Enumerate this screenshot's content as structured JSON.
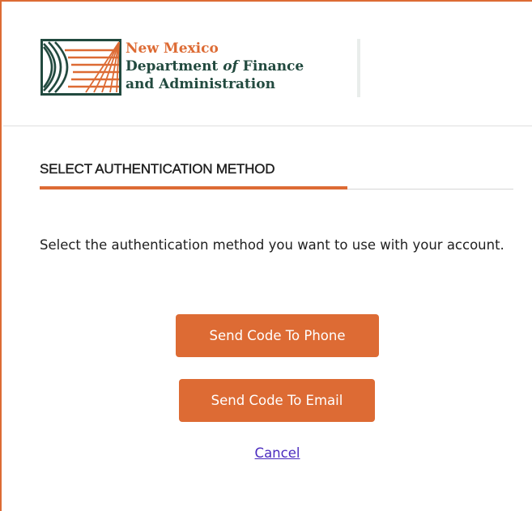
{
  "organization": {
    "line1": "New Mexico",
    "line2_prefix": "Department ",
    "line2_italic": "of",
    "line2_suffix": " Finance",
    "line3": "and Administration",
    "logo_icon": "nm-dfa-sunrise-logo-icon"
  },
  "section": {
    "title": "SELECT AUTHENTICATION METHOD"
  },
  "instructions": "Select the authentication method you want to use with your account.",
  "actions": {
    "phone_label": "Send Code To Phone",
    "email_label": "Send Code To Email",
    "cancel_label": "Cancel"
  },
  "colors": {
    "accent": "#dd6b34",
    "brand_green": "#224a3f",
    "link": "#4b2bbf"
  }
}
